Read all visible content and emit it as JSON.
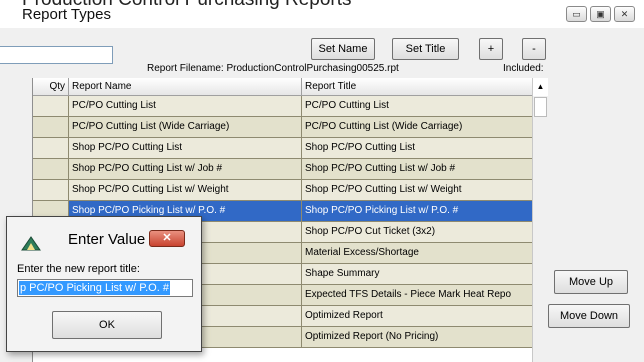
{
  "window": {
    "background_title": "Production Control Purchasing Reports",
    "title": "Report Types",
    "controls": {
      "minimize": "▭",
      "maximize": "▣",
      "close": "✕"
    }
  },
  "toolbar": {
    "set_name": "Set Name",
    "set_title": "Set Title",
    "add": "+",
    "remove": "-"
  },
  "report": {
    "filename_label": "Report Filename: ProductionControlPurchasing00525.rpt",
    "included_label": "Included:"
  },
  "grid": {
    "headers": {
      "qty": "Qty",
      "name": "Report Name",
      "title": "Report Title"
    },
    "rows": [
      {
        "qty": "",
        "name": "PC/PO Cutting List",
        "title": "PC/PO Cutting List",
        "selected": false
      },
      {
        "qty": "",
        "name": "PC/PO Cutting List (Wide Carriage)",
        "title": "PC/PO Cutting List (Wide Carriage)",
        "selected": false
      },
      {
        "qty": "",
        "name": "Shop PC/PO Cutting List",
        "title": "Shop PC/PO Cutting List",
        "selected": false
      },
      {
        "qty": "",
        "name": "Shop PC/PO Cutting List w/ Job #",
        "title": "Shop PC/PO Cutting List w/ Job #",
        "selected": false
      },
      {
        "qty": "",
        "name": "Shop PC/PO Cutting List w/ Weight",
        "title": "Shop PC/PO Cutting List w/ Weight",
        "selected": false
      },
      {
        "qty": "",
        "name": "Shop PC/PO Picking List w/ P.O. #",
        "title": "Shop PC/PO Picking List w/ P.O. #",
        "selected": true
      },
      {
        "qty": "",
        "name": "",
        "title": "Shop PC/PO Cut Ticket (3x2)",
        "selected": false
      },
      {
        "qty": "",
        "name": "",
        "title": "Material Excess/Shortage",
        "selected": false
      },
      {
        "qty": "",
        "name": "",
        "title": "Shape Summary",
        "selected": false
      },
      {
        "qty": "",
        "name": "Mark Heat Repo",
        "title": "Expected TFS Details - Piece Mark Heat Repo",
        "selected": false
      },
      {
        "qty": "",
        "name": "",
        "title": "Optimized Report",
        "selected": false
      },
      {
        "qty": "",
        "name": "",
        "title": "Optimized Report (No Pricing)",
        "selected": false
      }
    ]
  },
  "side_buttons": {
    "move_up": "Move Up",
    "move_down": "Move Down"
  },
  "dialog": {
    "title": "Enter Value",
    "close": "✕",
    "prompt": "Enter the new report title:",
    "value": "p PC/PO Picking List w/ P.O. #",
    "ok": "OK"
  },
  "colors": {
    "row_even": "#eceadb",
    "row_odd": "#e3e1cc",
    "selection": "#3169c6",
    "dialog_close": "#c8432f"
  }
}
